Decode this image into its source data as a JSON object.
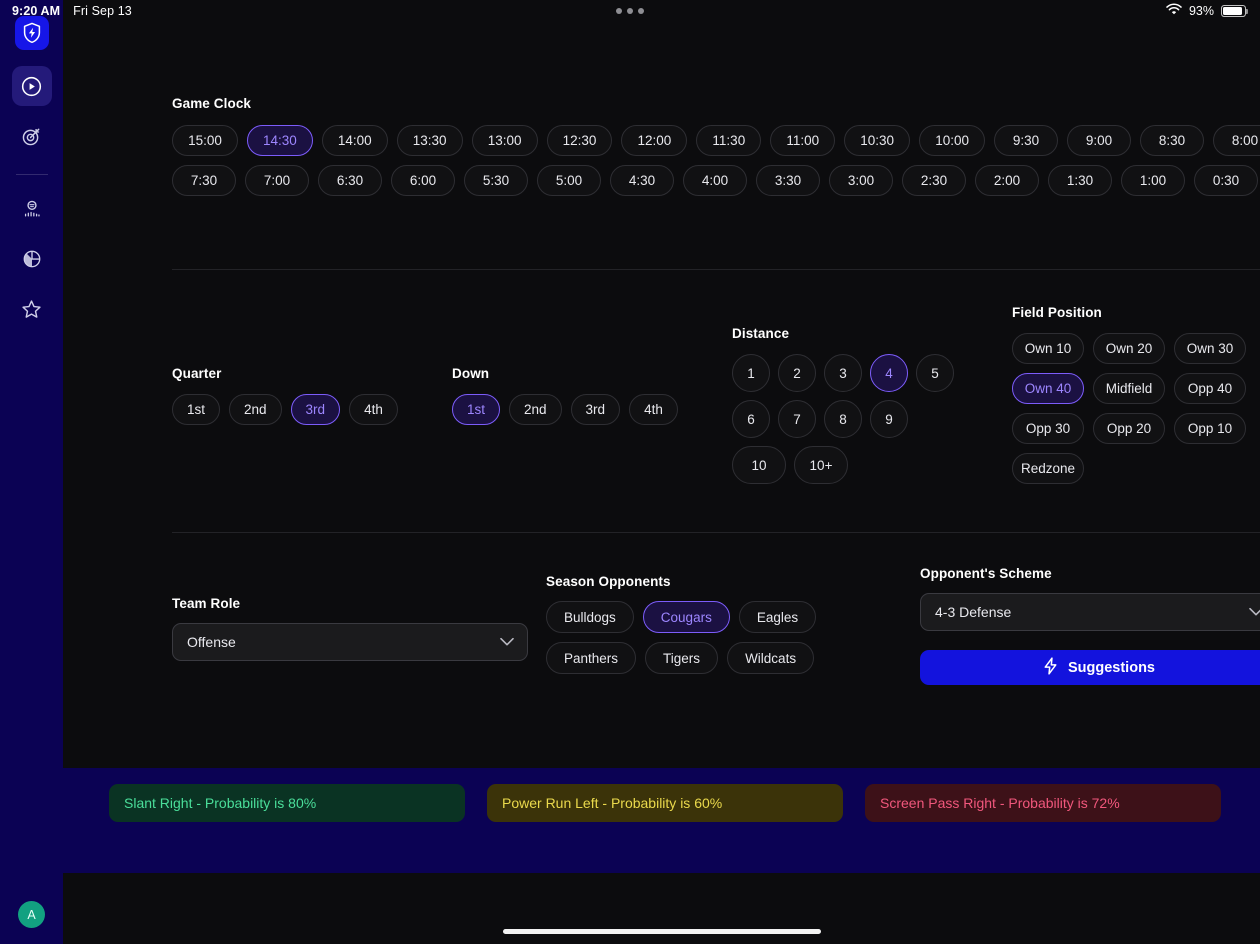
{
  "status_bar": {
    "time": "9:20 AM",
    "date": "Fri Sep 13",
    "battery_percent": "93%",
    "wifi_icon": "wifi-icon",
    "battery_icon": "battery-icon",
    "menu_dots_icon": "more-dots-icon"
  },
  "sidebar": {
    "logo_icon": "shield-bolt-logo-icon",
    "items": [
      {
        "icon": "play-circle-icon",
        "name": "sidebar-item-play",
        "active": true
      },
      {
        "icon": "target-arrow-icon",
        "name": "sidebar-item-target",
        "active": false
      },
      {
        "icon": "whistle-coach-icon",
        "name": "sidebar-item-coach",
        "active": false
      },
      {
        "icon": "pie-chart-icon",
        "name": "sidebar-item-analytics",
        "active": false
      },
      {
        "icon": "star-icon",
        "name": "sidebar-item-favorites",
        "active": false
      }
    ],
    "avatar_initial": "A"
  },
  "game_clock": {
    "label": "Game Clock",
    "selected": "14:30",
    "row1": [
      "15:00",
      "14:30",
      "14:00",
      "13:30",
      "13:00",
      "12:30",
      "12:00",
      "11:30",
      "11:00",
      "10:30",
      "10:00",
      "9:30",
      "9:00",
      "8:30",
      "8:00"
    ],
    "row2": [
      "7:30",
      "7:00",
      "6:30",
      "6:00",
      "5:30",
      "5:00",
      "4:30",
      "4:00",
      "3:30",
      "3:00",
      "2:30",
      "2:00",
      "1:30",
      "1:00",
      "0:30"
    ]
  },
  "quarter": {
    "label": "Quarter",
    "selected": "3rd",
    "options": [
      "1st",
      "2nd",
      "3rd",
      "4th"
    ]
  },
  "down": {
    "label": "Down",
    "selected": "1st",
    "options": [
      "1st",
      "2nd",
      "3rd",
      "4th"
    ]
  },
  "distance": {
    "label": "Distance",
    "selected": "4",
    "options": [
      "1",
      "2",
      "3",
      "4",
      "5",
      "6",
      "7",
      "8",
      "9",
      "10",
      "10+"
    ]
  },
  "field_position": {
    "label": "Field Position",
    "selected": "Own 40",
    "options": [
      "Own 10",
      "Own 20",
      "Own 30",
      "Own 40",
      "Midfield",
      "Opp 40",
      "Opp 30",
      "Opp 20",
      "Opp 10",
      "Redzone"
    ]
  },
  "team_role": {
    "label": "Team Role",
    "value": "Offense",
    "chevron_icon": "chevron-down-icon"
  },
  "season_opponents": {
    "label": "Season Opponents",
    "selected": "Cougars",
    "options": [
      "Bulldogs",
      "Cougars",
      "Eagles",
      "Panthers",
      "Tigers",
      "Wildcats"
    ]
  },
  "opponent_scheme": {
    "label": "Opponent's Scheme",
    "value": "4-3 Defense",
    "chevron_icon": "chevron-down-icon"
  },
  "suggestions_button": {
    "label": "Suggestions",
    "icon": "lightning-bolt-icon"
  },
  "results": [
    {
      "text": "Slant Right - Probability is 80%",
      "bg": "#0a3323",
      "fg": "#4ade9a"
    },
    {
      "text": "Power Run Left - Probability is 60%",
      "bg": "#3b3309",
      "fg": "#ead94c"
    },
    {
      "text": "Screen Pass Right - Probability is 72%",
      "bg": "#3d1118",
      "fg": "#f1577c"
    }
  ],
  "colors": {
    "accent_purple": "#7c5cfa",
    "accent_blue": "#1313dd",
    "sidebar_navy": "#0b0254",
    "background": "#0c0c0e"
  }
}
